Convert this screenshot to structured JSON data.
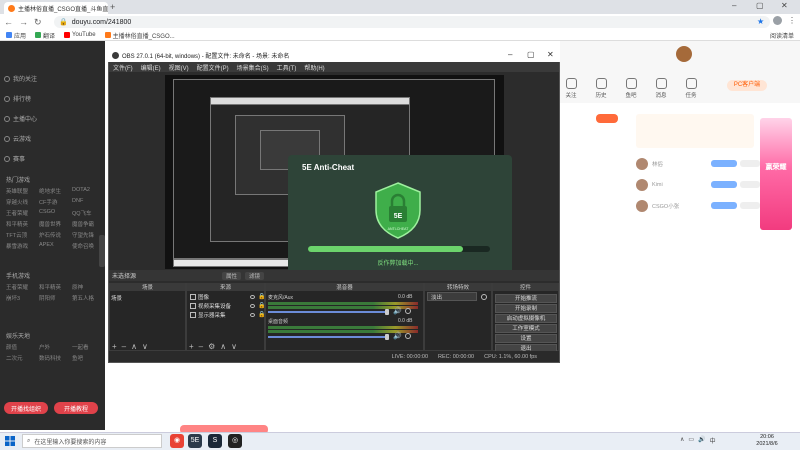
{
  "browser": {
    "tab_title": "主播林俗直播_CSGO直播_斗鱼直播",
    "url": "douyu.com/241800",
    "bookmarks": [
      "应用",
      "翻译",
      "YouTube",
      "主播林俗直播_CSGO..."
    ],
    "reading_list": "阅读清单"
  },
  "sidebar": {
    "items": [
      "我的关注",
      "排行榜",
      "主播中心",
      "云游戏",
      "赛事"
    ],
    "section_live": "热门游戏",
    "live_games": [
      "英雄联盟",
      "绝地求生",
      "DOTA2",
      "穿越火线",
      "CF手游",
      "DNF",
      "王者荣耀",
      "CSGO",
      "QQ飞车",
      "和平精英",
      "魔兽世界",
      "魔兽争霸",
      "TFT云顶",
      "炉石传说",
      "守望先锋",
      "暴雪游戏",
      "APEX",
      "使命召唤"
    ],
    "section_mobile": "手机游戏",
    "mobile_games": [
      "王者荣耀",
      "和平精英",
      "原神",
      "崩坏3",
      "阴阳师",
      "第五人格"
    ],
    "section_entertainment": "娱乐天地",
    "ent_items": [
      "颜值",
      "户外",
      "一起看",
      "二次元",
      "数码科技",
      "鱼吧"
    ],
    "btn_left": "开播找组织",
    "btn_right": "开播教程"
  },
  "right_panel": {
    "nav": [
      "关注",
      "历史",
      "鱼吧",
      "消息",
      "任务"
    ],
    "pc_button": "PC客户端",
    "ad_text": "赢荣耀",
    "rank_names": [
      "林俗",
      "Kimi",
      "CSGO小张"
    ]
  },
  "obs": {
    "title": "OBS 27.0.1 (64-bit, windows) - 配置文件: 未命名 - 场景: 未命名",
    "menu": [
      "文件(F)",
      "编辑(E)",
      "视图(V)",
      "配置文件(P)",
      "场景集合(S)",
      "工具(T)",
      "帮助(H)"
    ],
    "dock_header": "未选择源",
    "preview_btns": [
      "属性",
      "滤镜"
    ],
    "docks": [
      "场景",
      "来源",
      "混音器",
      "转场特效",
      "控件"
    ],
    "scene": "场景",
    "sources": [
      "图像",
      "视频采集设备",
      "显示器采集"
    ],
    "mixer": [
      {
        "name": "麦克风/Aux",
        "db": "0.0 dB"
      },
      {
        "name": "桌面音频",
        "db": "0.0 dB"
      }
    ],
    "transition": "淡出",
    "controls": [
      "开始推流",
      "开始录制",
      "启动虚拟摄像机",
      "工作室模式",
      "设置",
      "退出"
    ],
    "status": {
      "live": "LIVE: 00:00:00",
      "rec": "REC: 00:00:00",
      "cpu": "CPU: 1.1%, 60.00 fps"
    }
  },
  "anticheat": {
    "title": "5E Anti-Cheat",
    "shield_text": "5E",
    "shield_sub": "ANTI-CHEAT",
    "status": "反作弊加载中...",
    "progress": 0.85
  },
  "taskbar": {
    "search_placeholder": "在这里输入你要搜索的内容",
    "time": "20:06",
    "date": "2021/8/6"
  }
}
